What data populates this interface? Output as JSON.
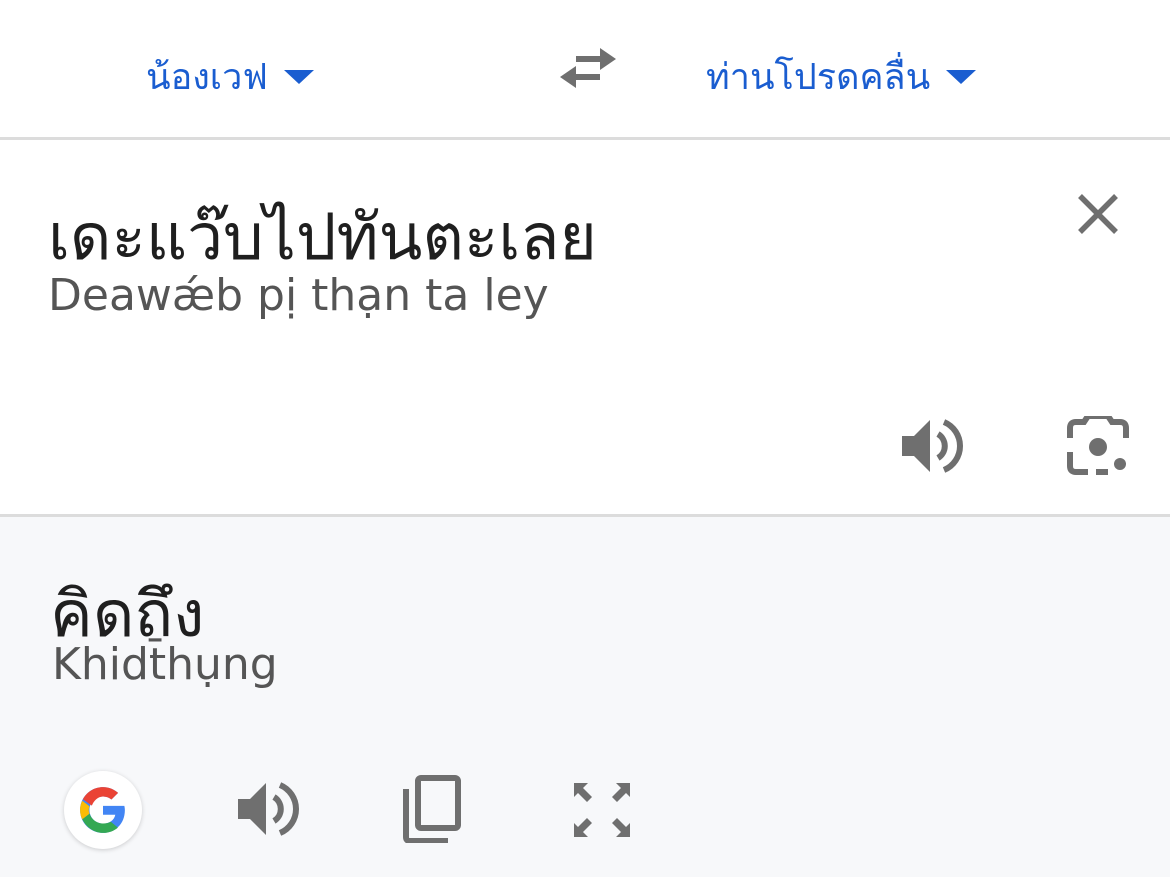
{
  "language_bar": {
    "source_language": "น้องเวฟ",
    "target_language": "ท่านโปรดคลื่น"
  },
  "source": {
    "text": "เดะแว๊บไปทันตะเลย",
    "transliteration": "Deawǽb pị thạn ta ley"
  },
  "result": {
    "text": "คิดถึง",
    "transliteration": "Khidt̄hụng"
  },
  "icons": {
    "swap": "swap-arrows-icon",
    "clear": "close-icon",
    "source_speaker": "speaker-icon",
    "lens": "camera-lens-icon",
    "google": "google-logo-icon",
    "result_speaker": "speaker-icon",
    "copy": "copy-icon",
    "fullscreen": "fullscreen-icon"
  },
  "colors": {
    "accent": "#1a5dd0",
    "icon": "#5f6368",
    "result_background": "#f7f8fa"
  }
}
